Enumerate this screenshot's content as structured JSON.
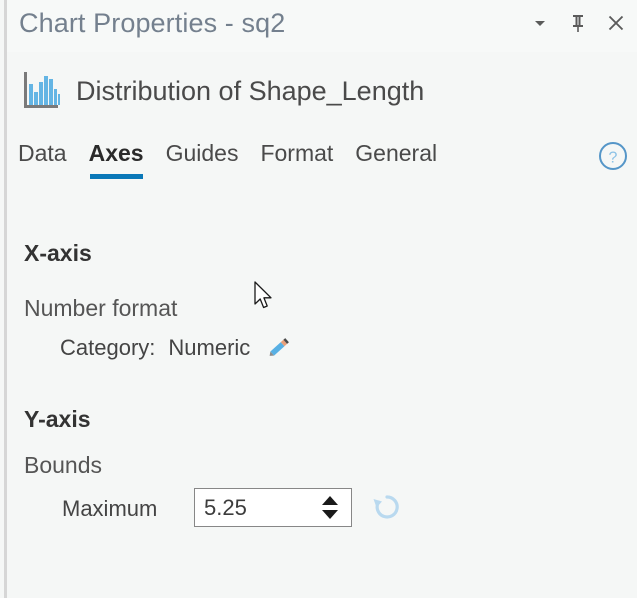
{
  "window": {
    "title": "Chart Properties - sq2",
    "controls": [
      {
        "name": "dropdown-chevron",
        "icon": "chevron-down-icon",
        "label": "Dropdown"
      },
      {
        "name": "pin",
        "icon": "pin-icon",
        "label": "Auto Hide"
      },
      {
        "name": "close",
        "icon": "close-icon",
        "label": "Close"
      }
    ]
  },
  "chart": {
    "icon": "histogram-icon",
    "title": "Distribution of Shape_Length"
  },
  "tabs": [
    {
      "label": "Data",
      "active": false
    },
    {
      "label": "Axes",
      "active": true
    },
    {
      "label": "Guides",
      "active": false
    },
    {
      "label": "Format",
      "active": false
    },
    {
      "label": "General",
      "active": false
    }
  ],
  "help": {
    "icon": "help-circle-icon",
    "label": "Help"
  },
  "sections": {
    "x_axis": {
      "header": "X-axis",
      "number_format": {
        "header": "Number format",
        "category_label": "Category:",
        "category_value": "Numeric",
        "edit_icon": "pencil-icon"
      }
    },
    "y_axis": {
      "header": "Y-axis",
      "bounds": {
        "header": "Bounds",
        "maximum_label": "Maximum",
        "maximum_value": "5.25",
        "maximum_placeholder": "",
        "reset_icon": "reset-arrow-icon"
      }
    }
  },
  "colors": {
    "accent_blue": "#0a78b8",
    "icon_blue": "#64b5e4",
    "title_text": "#74808e",
    "body_text": "#444444",
    "pane_background": "#f5f7f6",
    "input_border": "#878787"
  }
}
